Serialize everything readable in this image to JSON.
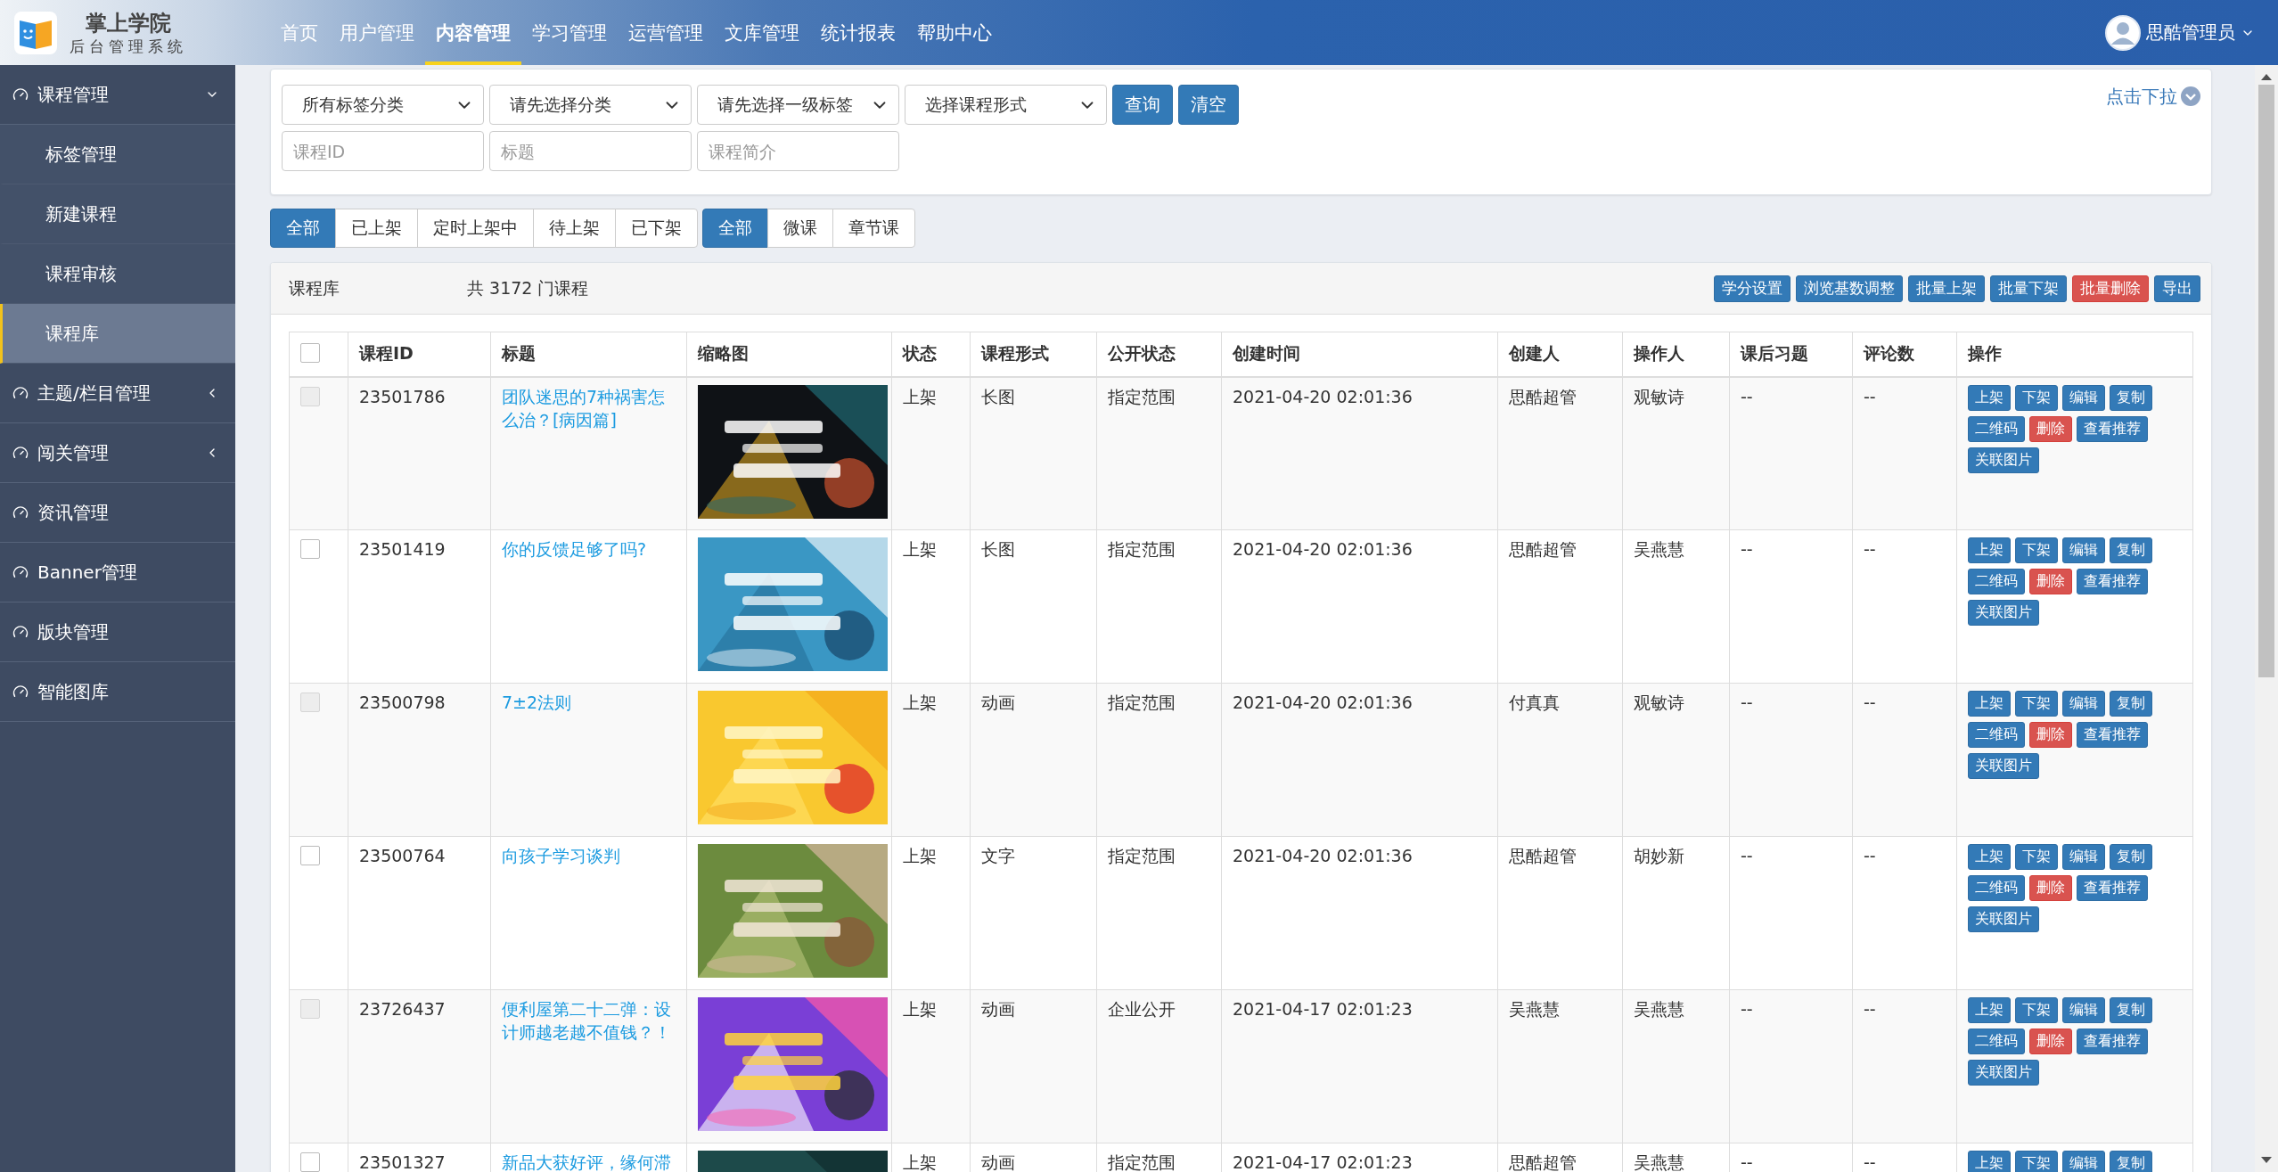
{
  "app": {
    "name": "掌上学院",
    "subtitle": "后台管理系统"
  },
  "nav": [
    {
      "label": "首页",
      "selected": false
    },
    {
      "label": "用户管理",
      "selected": false
    },
    {
      "label": "内容管理",
      "selected": true
    },
    {
      "label": "学习管理",
      "selected": false
    },
    {
      "label": "运营管理",
      "selected": false
    },
    {
      "label": "文库管理",
      "selected": false
    },
    {
      "label": "统计报表",
      "selected": false
    },
    {
      "label": "帮助中心",
      "selected": false
    }
  ],
  "user": {
    "name": "思酷管理员"
  },
  "sidebar": [
    {
      "label": "课程管理",
      "kind": "group",
      "expanded": true,
      "children": [
        {
          "label": "标签管理",
          "selected": false
        },
        {
          "label": "新建课程",
          "selected": false
        },
        {
          "label": "课程审核",
          "selected": false
        },
        {
          "label": "课程库",
          "selected": true
        }
      ]
    },
    {
      "label": "主题/栏目管理",
      "kind": "group",
      "expanded": false
    },
    {
      "label": "闯关管理",
      "kind": "group",
      "expanded": false
    },
    {
      "label": "资讯管理",
      "kind": "link"
    },
    {
      "label": "Banner管理",
      "kind": "link"
    },
    {
      "label": "版块管理",
      "kind": "link"
    },
    {
      "label": "智能图库",
      "kind": "link"
    }
  ],
  "filters": {
    "selects": [
      {
        "value": "所有标签分类"
      },
      {
        "value": "请先选择分类"
      },
      {
        "value": "请先选择一级标签"
      },
      {
        "value": "选择课程形式"
      }
    ],
    "buttons": [
      "查询",
      "清空"
    ],
    "inputs": [
      {
        "placeholder": "课程ID"
      },
      {
        "placeholder": "标题"
      },
      {
        "placeholder": "课程简介"
      }
    ],
    "toggle": "点击下拉"
  },
  "status_tabs": [
    {
      "label": "全部",
      "selected": true
    },
    {
      "label": "已上架",
      "selected": false
    },
    {
      "label": "定时上架中",
      "selected": false
    },
    {
      "label": "待上架",
      "selected": false
    },
    {
      "label": "已下架",
      "selected": false
    }
  ],
  "type_tabs": [
    {
      "label": "全部",
      "selected": true
    },
    {
      "label": "微课",
      "selected": false
    },
    {
      "label": "章节课",
      "selected": false
    }
  ],
  "library": {
    "title": "课程库",
    "count": "共 3172 门课程",
    "buttons": [
      {
        "label": "学分设置",
        "kind": "primary"
      },
      {
        "label": "浏览基数调整",
        "kind": "primary"
      },
      {
        "label": "批量上架",
        "kind": "primary"
      },
      {
        "label": "批量下架",
        "kind": "primary"
      },
      {
        "label": "批量删除",
        "kind": "danger"
      },
      {
        "label": "导出",
        "kind": "primary"
      }
    ]
  },
  "table": {
    "select_all": {
      "checked": false
    },
    "columns": [
      "课程ID",
      "标题",
      "缩略图",
      "状态",
      "课程形式",
      "公开状态",
      "创建时间",
      "创建人",
      "操作人",
      "课后习题",
      "评论数",
      "操作"
    ],
    "rows": [
      {
        "checked": false,
        "disabled": true,
        "id": "23501786",
        "title": "团队迷思的7种祸害怎么治？[病因篇]",
        "thumbnail": {
          "kind": "picture"
        },
        "status": "上架",
        "form": "长图",
        "visibility": "指定范围",
        "created": "2021-04-20 02:01:36",
        "creator": "思酷超管",
        "operator": "观敏诗",
        "exercises": "--",
        "comments": "--",
        "actions": [
          {
            "label": "上架",
            "kind": "primary"
          },
          {
            "label": "下架",
            "kind": "primary"
          },
          {
            "label": "编辑",
            "kind": "primary"
          },
          {
            "label": "复制",
            "kind": "primary"
          },
          {
            "label": "二维码",
            "kind": "primary"
          },
          {
            "label": "删除",
            "kind": "danger"
          },
          {
            "label": "查看推荐",
            "kind": "primary"
          },
          {
            "label": "关联图片",
            "kind": "primary"
          }
        ]
      },
      {
        "checked": false,
        "disabled": false,
        "id": "23501419",
        "title": "你的反馈足够了吗?",
        "thumbnail": {
          "kind": "picture"
        },
        "status": "上架",
        "form": "长图",
        "visibility": "指定范围",
        "created": "2021-04-20 02:01:36",
        "creator": "思酷超管",
        "operator": "吴燕慧",
        "exercises": "--",
        "comments": "--",
        "actions": [
          {
            "label": "上架",
            "kind": "primary"
          },
          {
            "label": "下架",
            "kind": "primary"
          },
          {
            "label": "编辑",
            "kind": "primary"
          },
          {
            "label": "复制",
            "kind": "primary"
          },
          {
            "label": "二维码",
            "kind": "primary"
          },
          {
            "label": "删除",
            "kind": "danger"
          },
          {
            "label": "查看推荐",
            "kind": "primary"
          },
          {
            "label": "关联图片",
            "kind": "primary"
          }
        ]
      },
      {
        "checked": false,
        "disabled": true,
        "id": "23500798",
        "title": "7±2法则",
        "thumbnail": {
          "kind": "picture"
        },
        "status": "上架",
        "form": "动画",
        "visibility": "指定范围",
        "created": "2021-04-20 02:01:36",
        "creator": "付真真",
        "operator": "观敏诗",
        "exercises": "--",
        "comments": "--",
        "actions": [
          {
            "label": "上架",
            "kind": "primary"
          },
          {
            "label": "下架",
            "kind": "primary"
          },
          {
            "label": "编辑",
            "kind": "primary"
          },
          {
            "label": "复制",
            "kind": "primary"
          },
          {
            "label": "二维码",
            "kind": "primary"
          },
          {
            "label": "删除",
            "kind": "danger"
          },
          {
            "label": "查看推荐",
            "kind": "primary"
          },
          {
            "label": "关联图片",
            "kind": "primary"
          }
        ]
      },
      {
        "checked": false,
        "disabled": false,
        "id": "23500764",
        "title": "向孩子学习谈判",
        "thumbnail": {
          "kind": "picture"
        },
        "status": "上架",
        "form": "文字",
        "visibility": "指定范围",
        "created": "2021-04-20 02:01:36",
        "creator": "思酷超管",
        "operator": "胡妙新",
        "exercises": "--",
        "comments": "--",
        "actions": [
          {
            "label": "上架",
            "kind": "primary"
          },
          {
            "label": "下架",
            "kind": "primary"
          },
          {
            "label": "编辑",
            "kind": "primary"
          },
          {
            "label": "复制",
            "kind": "primary"
          },
          {
            "label": "二维码",
            "kind": "primary"
          },
          {
            "label": "删除",
            "kind": "danger"
          },
          {
            "label": "查看推荐",
            "kind": "primary"
          },
          {
            "label": "关联图片",
            "kind": "primary"
          }
        ]
      },
      {
        "checked": false,
        "disabled": true,
        "id": "23726437",
        "title": "便利屋第二十二弹：设计师越老越不值钱？！",
        "thumbnail": {
          "kind": "picture"
        },
        "status": "上架",
        "form": "动画",
        "visibility": "企业公开",
        "created": "2021-04-17 02:01:23",
        "creator": "吴燕慧",
        "operator": "吴燕慧",
        "exercises": "--",
        "comments": "--",
        "actions": [
          {
            "label": "上架",
            "kind": "primary"
          },
          {
            "label": "下架",
            "kind": "primary"
          },
          {
            "label": "编辑",
            "kind": "primary"
          },
          {
            "label": "复制",
            "kind": "primary"
          },
          {
            "label": "二维码",
            "kind": "primary"
          },
          {
            "label": "删除",
            "kind": "danger"
          },
          {
            "label": "查看推荐",
            "kind": "primary"
          },
          {
            "label": "关联图片",
            "kind": "primary"
          }
        ]
      },
      {
        "checked": false,
        "disabled": false,
        "id": "23501327",
        "title": "新品大获好评，缘何滞",
        "thumbnail": {
          "kind": "picture"
        },
        "status": "上架",
        "form": "动画",
        "visibility": "指定范围",
        "created": "2021-04-17 02:01:23",
        "creator": "思酷超管",
        "operator": "吴燕慧",
        "exercises": "--",
        "comments": "--",
        "actions": [
          {
            "label": "上架",
            "kind": "primary"
          },
          {
            "label": "下架",
            "kind": "primary"
          },
          {
            "label": "编辑",
            "kind": "primary"
          },
          {
            "label": "复制",
            "kind": "primary"
          }
        ]
      }
    ]
  }
}
